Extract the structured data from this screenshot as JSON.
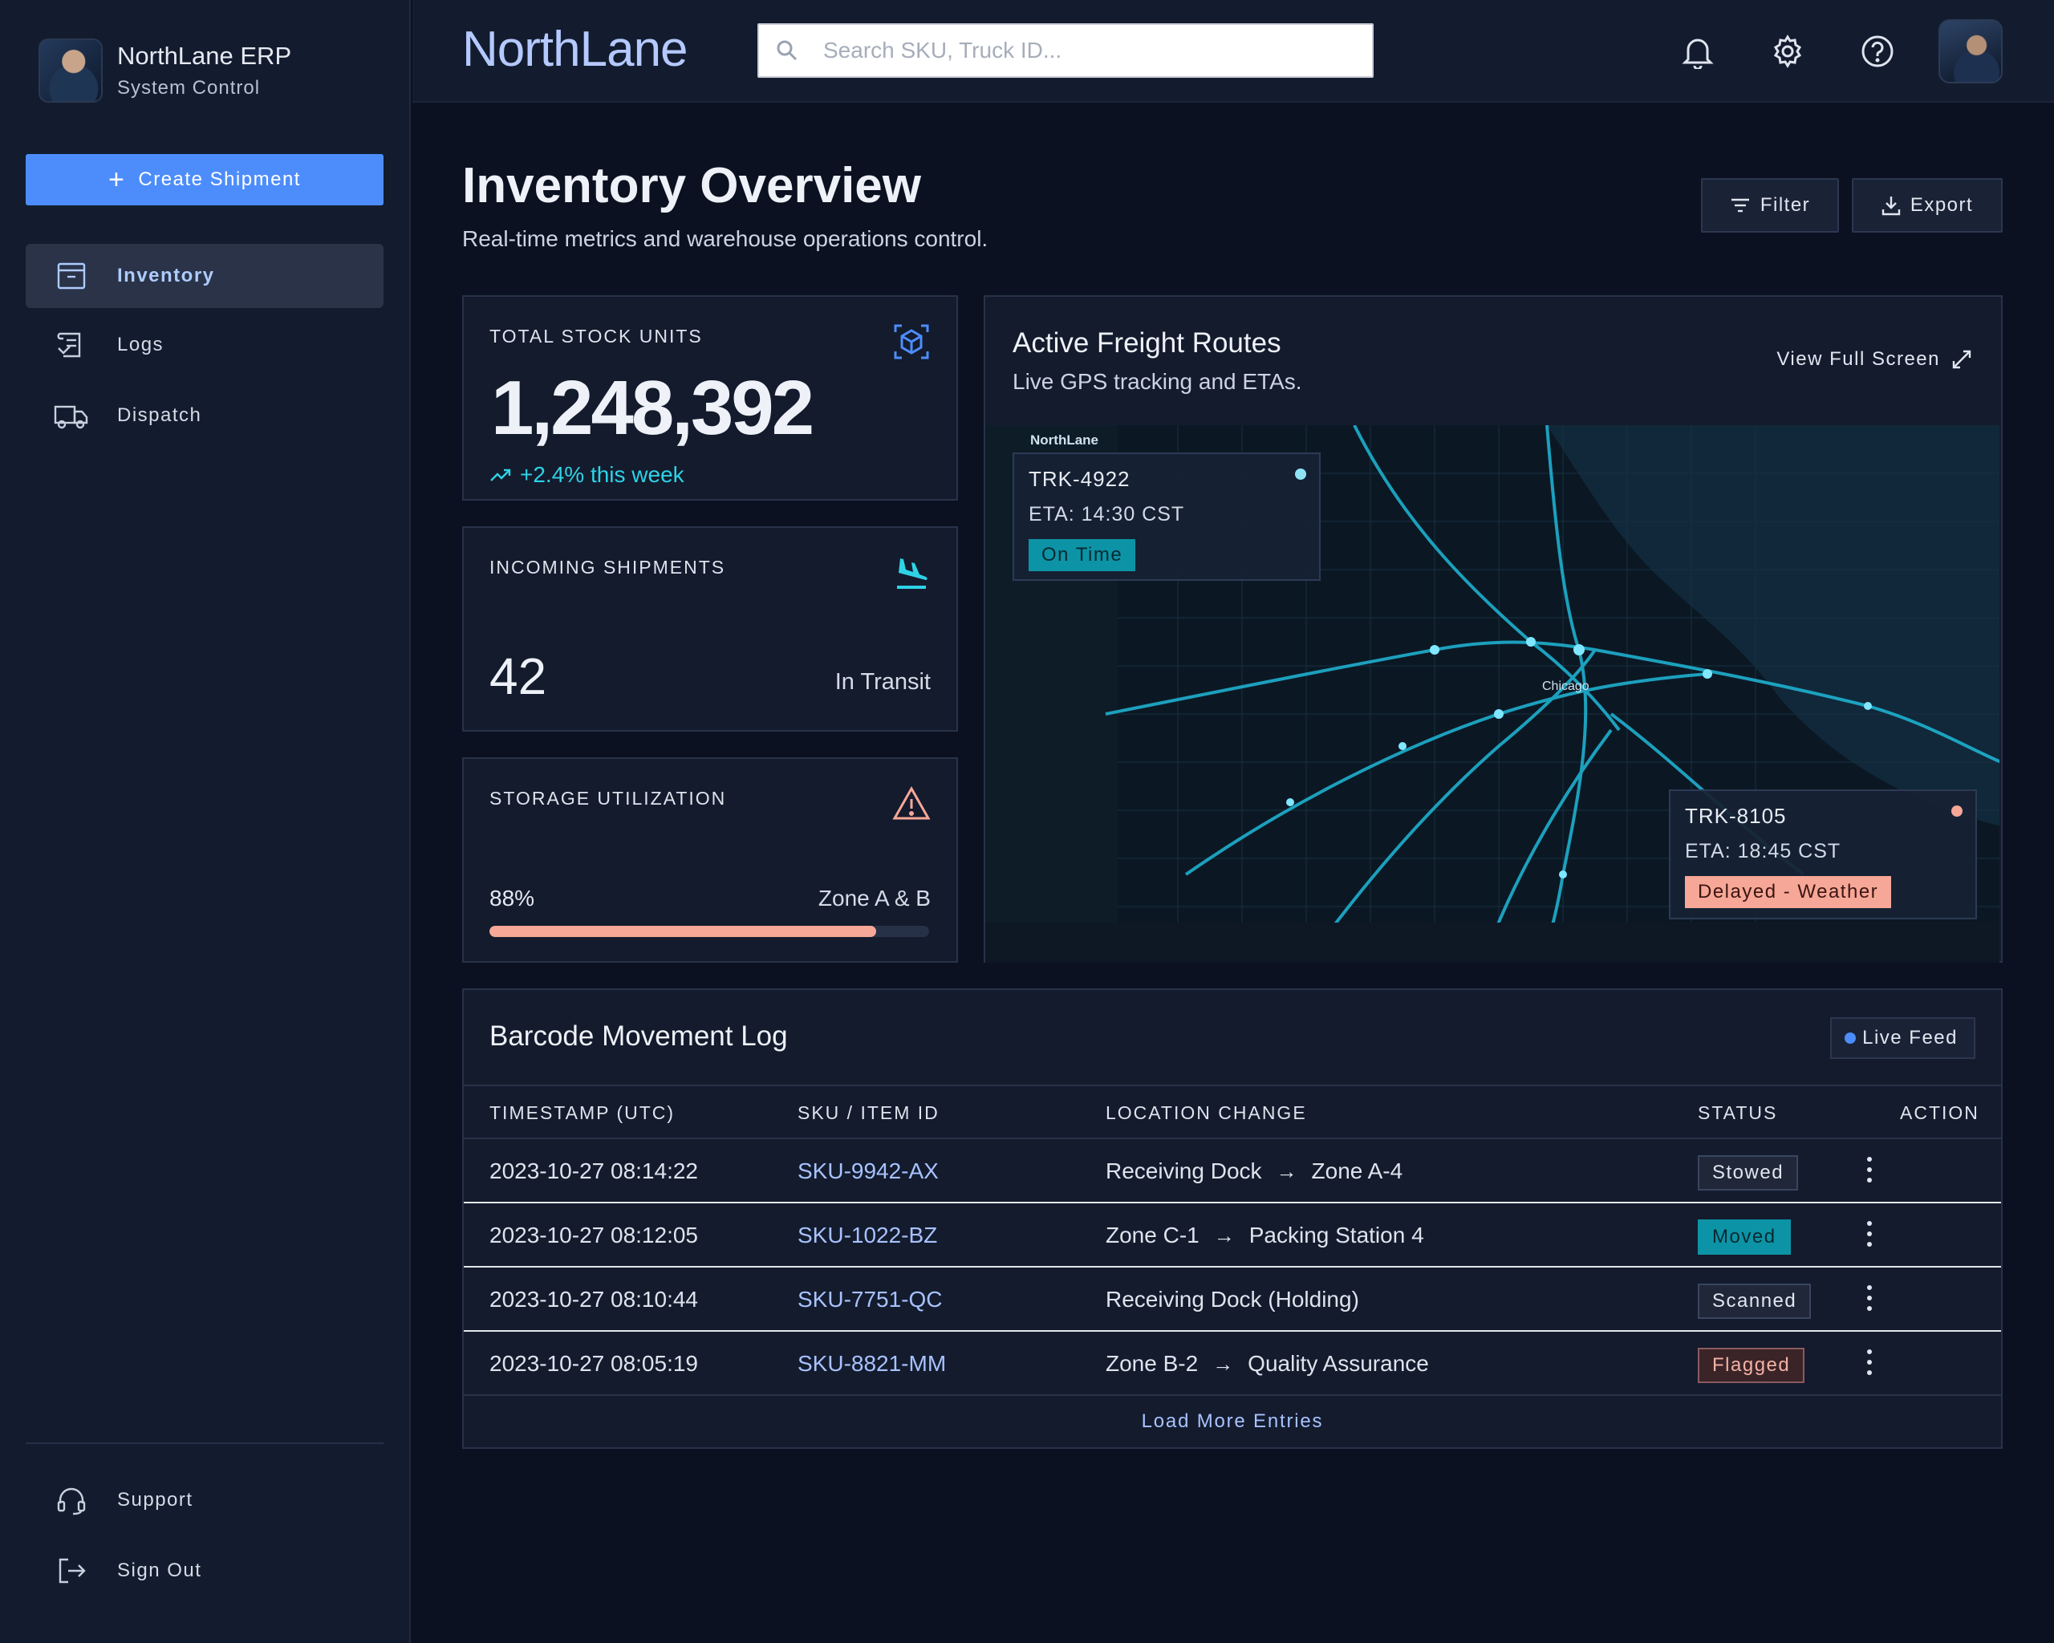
{
  "sidebar": {
    "brand_title": "NorthLane ERP",
    "brand_subtitle": "System Control",
    "create_label": "Create Shipment",
    "nav": [
      {
        "label": "Inventory",
        "icon": "archive-box-icon",
        "active": true
      },
      {
        "label": "Logs",
        "icon": "logs-icon",
        "active": false
      },
      {
        "label": "Dispatch",
        "icon": "truck-icon",
        "active": false
      }
    ],
    "footer": [
      {
        "label": "Support",
        "icon": "headset-icon"
      },
      {
        "label": "Sign Out",
        "icon": "sign-out-icon"
      }
    ]
  },
  "topbar": {
    "logo": "NorthLane",
    "search_placeholder": "Search SKU, Truck ID...",
    "icons": [
      "bell-icon",
      "gear-icon",
      "help-icon"
    ]
  },
  "header": {
    "title": "Inventory Overview",
    "subtitle": "Real-time metrics and warehouse operations control.",
    "filter_label": "Filter",
    "export_label": "Export"
  },
  "stats": {
    "stock": {
      "label": "TOTAL STOCK UNITS",
      "value": "1,248,392",
      "delta": "+2.4% this week"
    },
    "incoming": {
      "label": "INCOMING SHIPMENTS",
      "value": "42",
      "unit": "In Transit"
    },
    "storage": {
      "label": "STORAGE UTILIZATION",
      "value": "88%",
      "percent": 88,
      "zone": "Zone A & B"
    }
  },
  "map": {
    "title": "Active Freight Routes",
    "subtitle": "Live GPS tracking and ETAs.",
    "link_label": "View Full Screen",
    "trucks": [
      {
        "id": "TRK-4922",
        "eta": "ETA: 14:30 CST",
        "status": "On Time",
        "dot": "#8fe3f5"
      },
      {
        "id": "TRK-8105",
        "eta": "ETA: 18:45 CST",
        "status": "Delayed - Weather",
        "dot": "#f7a797"
      }
    ]
  },
  "log": {
    "title": "Barcode Movement Log",
    "live_label": "Live Feed",
    "columns": [
      "TIMESTAMP (UTC)",
      "SKU / ITEM ID",
      "LOCATION CHANGE",
      "STATUS",
      "ACTION"
    ],
    "rows": [
      {
        "timestamp": "2023-10-27 08:14:22",
        "sku": "SKU-9942-AX",
        "from": "Receiving Dock",
        "to": "Zone A-4",
        "status": "Stowed",
        "kind": "neutral"
      },
      {
        "timestamp": "2023-10-27 08:12:05",
        "sku": "SKU-1022-BZ",
        "from": "Zone C-1",
        "to": "Packing Station 4",
        "status": "Moved",
        "kind": "moved"
      },
      {
        "timestamp": "2023-10-27 08:10:44",
        "sku": "SKU-7751-QC",
        "from": "Receiving Dock (Holding)",
        "to": "",
        "status": "Scanned",
        "kind": "neutral"
      },
      {
        "timestamp": "2023-10-27 08:05:19",
        "sku": "SKU-8821-MM",
        "from": "Zone B-2",
        "to": "Quality Assurance",
        "status": "Flagged",
        "kind": "flag"
      }
    ],
    "load_more": "Load More Entries"
  },
  "colors": {
    "accent": "#4d8dfb",
    "teal": "#2ed3e6",
    "warning": "#f7a797",
    "background": "#0b1120"
  }
}
